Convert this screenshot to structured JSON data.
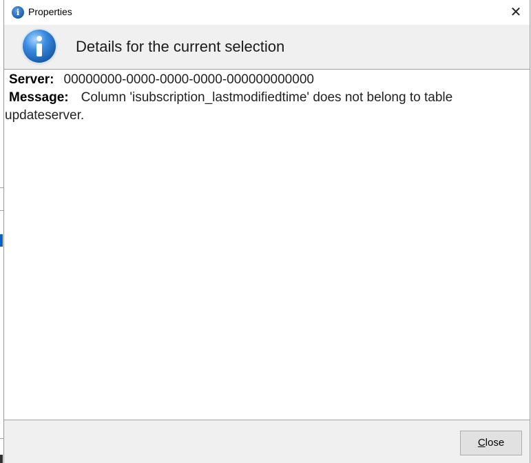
{
  "window": {
    "title": "Properties",
    "close_glyph": "✕",
    "icon": "info-icon"
  },
  "header": {
    "title": "Details for the current selection",
    "icon": "info-large-icon"
  },
  "details": {
    "server_label": "Server:",
    "server_value": "00000000-0000-0000-0000-000000000000",
    "message_label": "Message:",
    "message_value": "Column 'isubscription_lastmodifiedtime' does not belong to table updateserver."
  },
  "footer": {
    "close_label_mnemonic": "C",
    "close_label_rest": "lose"
  },
  "colors": {
    "accent": "#1f5fae",
    "dialog_bg": "#f0f0f0",
    "content_bg": "#ffffff"
  }
}
